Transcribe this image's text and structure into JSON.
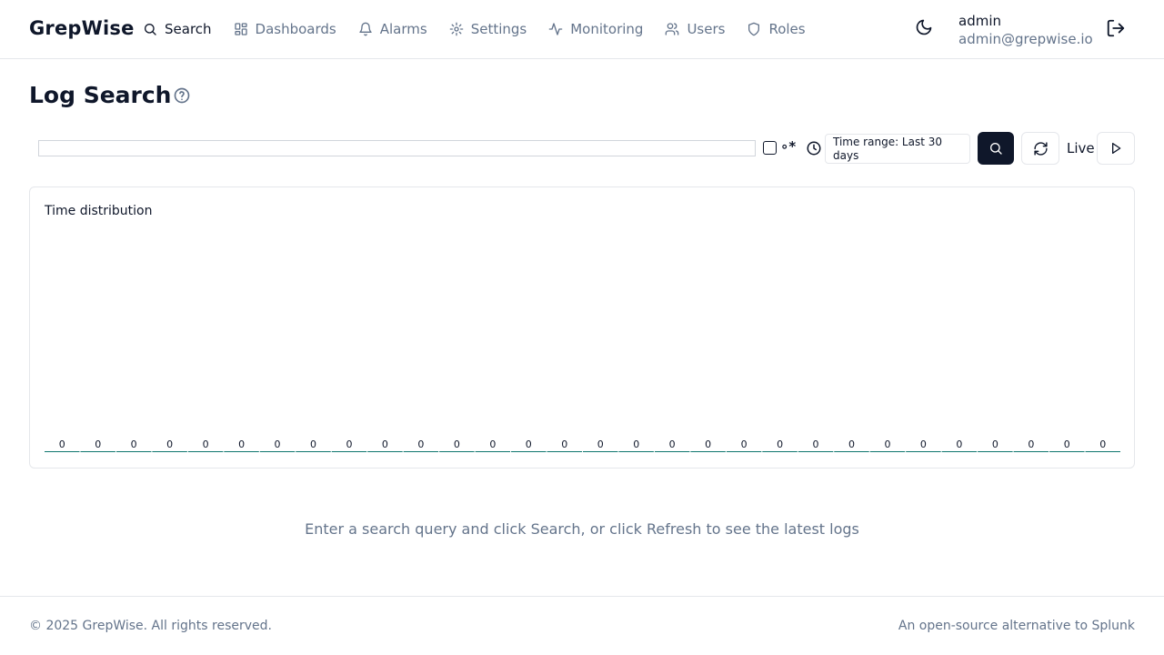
{
  "header": {
    "brand": "GrepWise",
    "nav": [
      {
        "label": "Search",
        "icon": "search-icon"
      },
      {
        "label": "Dashboards",
        "icon": "dashboard-grid-icon"
      },
      {
        "label": "Alarms",
        "icon": "bell-icon"
      },
      {
        "label": "Settings",
        "icon": "gear-icon"
      },
      {
        "label": "Monitoring",
        "icon": "activity-icon"
      },
      {
        "label": "Users",
        "icon": "users-icon"
      },
      {
        "label": "Roles",
        "icon": "shield-icon"
      }
    ],
    "user": {
      "name": "admin",
      "email": "admin@grepwise.io"
    }
  },
  "page": {
    "title": "Log Search"
  },
  "search": {
    "query": "",
    "regex_symbol": "∘*",
    "time_range_label": "Time range: Last 30 days",
    "live_label": "Live"
  },
  "histogram": {
    "title": "Time distribution"
  },
  "chart_data": {
    "type": "bar",
    "title": "Time distribution",
    "categories": [],
    "values": [
      0,
      0,
      0,
      0,
      0,
      0,
      0,
      0,
      0,
      0,
      0,
      0,
      0,
      0,
      0,
      0,
      0,
      0,
      0,
      0,
      0,
      0,
      0,
      0,
      0,
      0,
      0,
      0,
      0,
      0
    ],
    "data_labels": [
      "0",
      "0",
      "0",
      "0",
      "0",
      "0",
      "0",
      "0",
      "0",
      "0",
      "0",
      "0",
      "0",
      "0",
      "0",
      "0",
      "0",
      "0",
      "0",
      "0",
      "0",
      "0",
      "0",
      "0",
      "0",
      "0",
      "0",
      "0",
      "0",
      "0"
    ],
    "bar_color": "#0f766e"
  },
  "empty_state": "Enter a search query and click Search, or click Refresh to see the latest logs",
  "footer": {
    "copyright": "© 2025 GrepWise. All rights reserved.",
    "tagline": "An open-source alternative to Splunk"
  }
}
